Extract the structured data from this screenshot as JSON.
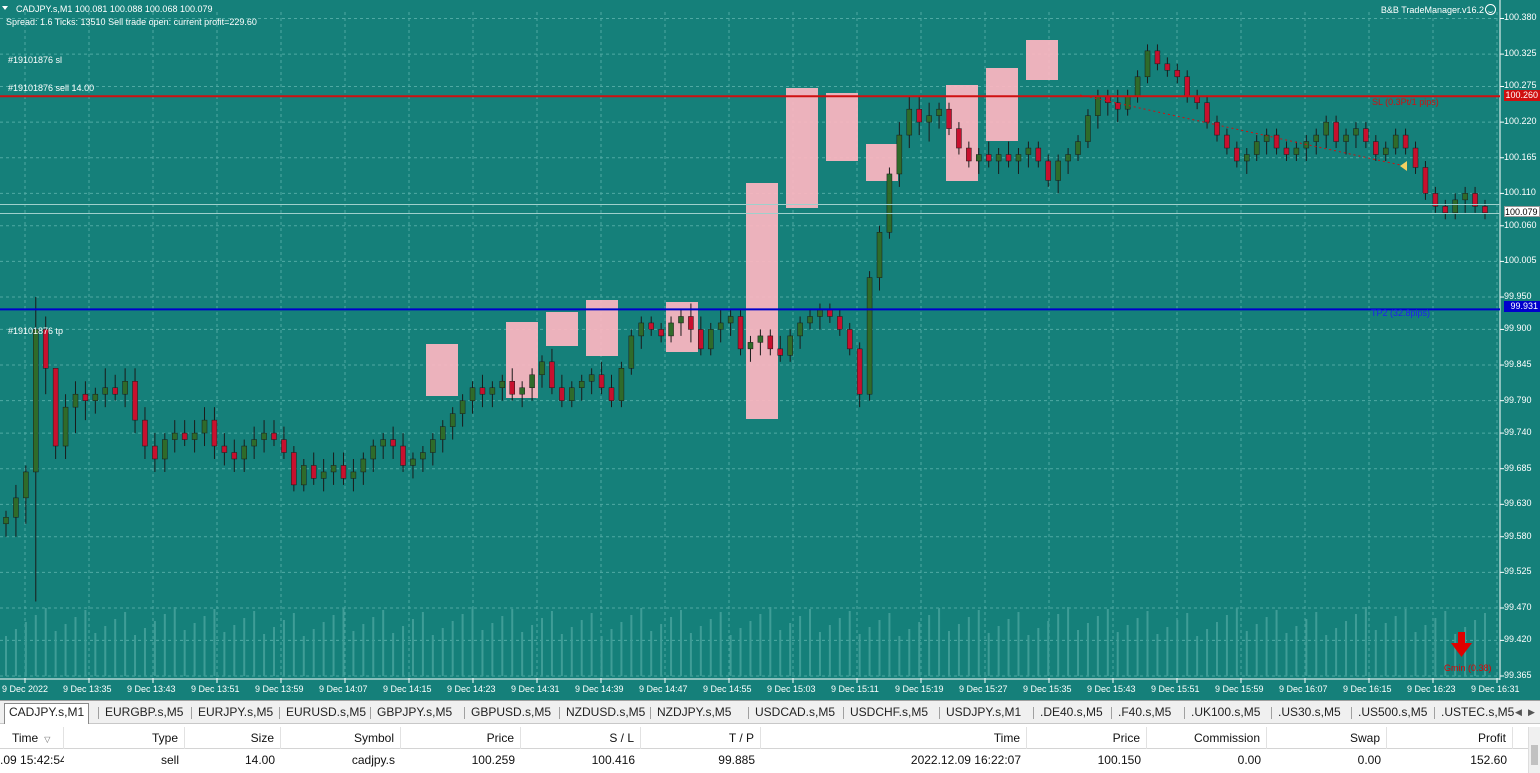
{
  "header": {
    "title": "CADJPY.s,M1  100.081 100.088 100.068 100.079",
    "info": "Spread: 1.6   Ticks: 13510   Sell trade open: current profit=229.60",
    "tm_title": "B&B TradeManager.v16.2"
  },
  "annotations": {
    "sl_order": "#19101876 sl",
    "sell_order": "#19101876 sell 14.00",
    "tp_order": "#19101876 tp",
    "sl_label": "SL (0.3Pt/1 pips)",
    "tp_label": "TP2 (32.8pips)",
    "signal_label": "Gmin (0.38)"
  },
  "price_badges": {
    "sl": "100.260",
    "current": "100.079",
    "tp": "99.931"
  },
  "colors": {
    "chart_bg": "#15807a",
    "bull": "#2f6b2a",
    "bear": "#c8102e",
    "sl_line": "#d01010",
    "tp_line": "#0000cc",
    "box": "#ffb6c1"
  },
  "icons": {
    "signal": "red-down-arrow-icon",
    "status": "smiley-icon",
    "collapse": "triangle-down-icon"
  },
  "chart_data": {
    "type": "candlestick",
    "symbol": "CADJPY.s",
    "timeframe": "M1",
    "y_ticks": [
      100.38,
      100.325,
      100.275,
      100.22,
      100.165,
      100.11,
      100.06,
      100.005,
      99.95,
      99.9,
      99.845,
      99.79,
      99.74,
      99.685,
      99.63,
      99.58,
      99.525,
      99.47,
      99.42,
      99.365
    ],
    "y_ticks_text": [
      "100.380",
      "100.325",
      "100.275",
      "100.220",
      "100.165",
      "100.110",
      "100.060",
      "100.005",
      "99.950",
      "99.900",
      "99.845",
      "99.790",
      "99.740",
      "99.685",
      "99.630",
      "99.580",
      "99.525",
      "99.470",
      "99.420",
      "99.365"
    ],
    "ylim": [
      99.365,
      100.39
    ],
    "x_ticks": [
      "9 Dec 2022",
      "9 Dec 13:35",
      "9 Dec 13:43",
      "9 Dec 13:51",
      "9 Dec 13:59",
      "9 Dec 14:07",
      "9 Dec 14:15",
      "9 Dec 14:23",
      "9 Dec 14:31",
      "9 Dec 14:39",
      "9 Dec 14:47",
      "9 Dec 14:55",
      "9 Dec 15:03",
      "9 Dec 15:11",
      "9 Dec 15:19",
      "9 Dec 15:27",
      "9 Dec 15:35",
      "9 Dec 15:43",
      "9 Dec 15:51",
      "9 Dec 15:59",
      "9 Dec 16:07",
      "9 Dec 16:15",
      "9 Dec 16:23",
      "9 Dec 16:31"
    ],
    "sl_price": 100.26,
    "tp_price": 99.931,
    "current_price": 100.079,
    "grid": true,
    "candles": [
      [
        99.6,
        99.62,
        99.58,
        99.61
      ],
      [
        99.61,
        99.66,
        99.58,
        99.64
      ],
      [
        99.64,
        99.69,
        99.6,
        99.68
      ],
      [
        99.68,
        99.95,
        99.48,
        99.9
      ],
      [
        99.9,
        99.92,
        99.8,
        99.84
      ],
      [
        99.84,
        99.82,
        99.7,
        99.72
      ],
      [
        99.72,
        99.8,
        99.7,
        99.78
      ],
      [
        99.78,
        99.82,
        99.74,
        99.8
      ],
      [
        99.8,
        99.82,
        99.76,
        99.79
      ],
      [
        99.79,
        99.81,
        99.77,
        99.8
      ],
      [
        99.8,
        99.84,
        99.78,
        99.81
      ],
      [
        99.81,
        99.83,
        99.79,
        99.8
      ],
      [
        99.8,
        99.84,
        99.78,
        99.82
      ],
      [
        99.82,
        99.84,
        99.74,
        99.76
      ],
      [
        99.76,
        99.78,
        99.7,
        99.72
      ],
      [
        99.72,
        99.74,
        99.68,
        99.7
      ],
      [
        99.7,
        99.74,
        99.68,
        99.73
      ],
      [
        99.73,
        99.76,
        99.71,
        99.74
      ],
      [
        99.74,
        99.76,
        99.72,
        99.73
      ],
      [
        99.73,
        99.76,
        99.71,
        99.74
      ],
      [
        99.74,
        99.78,
        99.72,
        99.76
      ],
      [
        99.76,
        99.78,
        99.7,
        99.72
      ],
      [
        99.72,
        99.74,
        99.69,
        99.71
      ],
      [
        99.71,
        99.73,
        99.68,
        99.7
      ],
      [
        99.7,
        99.73,
        99.68,
        99.72
      ],
      [
        99.72,
        99.75,
        99.7,
        99.73
      ],
      [
        99.73,
        99.76,
        99.71,
        99.74
      ],
      [
        99.74,
        99.76,
        99.72,
        99.73
      ],
      [
        99.73,
        99.75,
        99.7,
        99.71
      ],
      [
        99.71,
        99.72,
        99.65,
        99.66
      ],
      [
        99.66,
        99.7,
        99.65,
        99.69
      ],
      [
        99.69,
        99.71,
        99.66,
        99.67
      ],
      [
        99.67,
        99.7,
        99.65,
        99.68
      ],
      [
        99.68,
        99.71,
        99.66,
        99.69
      ],
      [
        99.69,
        99.71,
        99.66,
        99.67
      ],
      [
        99.67,
        99.7,
        99.65,
        99.68
      ],
      [
        99.68,
        99.71,
        99.66,
        99.7
      ],
      [
        99.7,
        99.73,
        99.68,
        99.72
      ],
      [
        99.72,
        99.74,
        99.7,
        99.73
      ],
      [
        99.73,
        99.75,
        99.7,
        99.72
      ],
      [
        99.72,
        99.74,
        99.68,
        99.69
      ],
      [
        99.69,
        99.71,
        99.67,
        99.7
      ],
      [
        99.7,
        99.72,
        99.68,
        99.71
      ],
      [
        99.71,
        99.74,
        99.69,
        99.73
      ],
      [
        99.73,
        99.76,
        99.71,
        99.75
      ],
      [
        99.75,
        99.78,
        99.73,
        99.77
      ],
      [
        99.77,
        99.8,
        99.75,
        99.79
      ],
      [
        99.79,
        99.82,
        99.77,
        99.81
      ],
      [
        99.81,
        99.83,
        99.78,
        99.8
      ],
      [
        99.8,
        99.82,
        99.78,
        99.81
      ],
      [
        99.81,
        99.83,
        99.79,
        99.82
      ],
      [
        99.82,
        99.84,
        99.79,
        99.8
      ],
      [
        99.8,
        99.82,
        99.78,
        99.81
      ],
      [
        99.81,
        99.84,
        99.79,
        99.83
      ],
      [
        99.83,
        99.86,
        99.81,
        99.85
      ],
      [
        99.85,
        99.87,
        99.8,
        99.81
      ],
      [
        99.81,
        99.83,
        99.78,
        99.79
      ],
      [
        99.79,
        99.82,
        99.78,
        99.81
      ],
      [
        99.81,
        99.83,
        99.79,
        99.82
      ],
      [
        99.82,
        99.84,
        99.8,
        99.83
      ],
      [
        99.83,
        99.85,
        99.8,
        99.81
      ],
      [
        99.81,
        99.83,
        99.78,
        99.79
      ],
      [
        99.79,
        99.85,
        99.78,
        99.84
      ],
      [
        99.84,
        99.9,
        99.83,
        99.89
      ],
      [
        99.89,
        99.92,
        99.87,
        99.91
      ],
      [
        99.91,
        99.92,
        99.89,
        99.9
      ],
      [
        99.9,
        99.91,
        99.88,
        99.89
      ],
      [
        99.89,
        99.92,
        99.88,
        99.91
      ],
      [
        99.91,
        99.93,
        99.89,
        99.92
      ],
      [
        99.92,
        99.94,
        99.88,
        99.9
      ],
      [
        99.9,
        99.92,
        99.86,
        99.87
      ],
      [
        99.87,
        99.91,
        99.86,
        99.9
      ],
      [
        99.9,
        99.93,
        99.88,
        99.91
      ],
      [
        99.91,
        99.93,
        99.89,
        99.92
      ],
      [
        99.92,
        99.93,
        99.86,
        99.87
      ],
      [
        99.87,
        99.89,
        99.85,
        99.88
      ],
      [
        99.88,
        99.9,
        99.86,
        99.89
      ],
      [
        99.89,
        99.9,
        99.86,
        99.87
      ],
      [
        99.87,
        99.89,
        99.85,
        99.86
      ],
      [
        99.86,
        99.9,
        99.85,
        99.89
      ],
      [
        99.89,
        99.92,
        99.87,
        99.91
      ],
      [
        99.91,
        99.93,
        99.9,
        99.92
      ],
      [
        99.92,
        99.94,
        99.9,
        99.93
      ],
      [
        99.93,
        99.94,
        99.91,
        99.92
      ],
      [
        99.92,
        99.93,
        99.89,
        99.9
      ],
      [
        99.9,
        99.91,
        99.86,
        99.87
      ],
      [
        99.87,
        99.88,
        99.78,
        99.8
      ],
      [
        99.8,
        99.99,
        99.79,
        99.98
      ],
      [
        99.98,
        100.06,
        99.96,
        100.05
      ],
      [
        100.05,
        100.15,
        100.04,
        100.14
      ],
      [
        100.14,
        100.22,
        100.12,
        100.2
      ],
      [
        100.2,
        100.26,
        100.18,
        100.24
      ],
      [
        100.24,
        100.26,
        100.2,
        100.22
      ],
      [
        100.22,
        100.25,
        100.19,
        100.23
      ],
      [
        100.23,
        100.25,
        100.21,
        100.24
      ],
      [
        100.24,
        100.25,
        100.2,
        100.21
      ],
      [
        100.21,
        100.22,
        100.17,
        100.18
      ],
      [
        100.18,
        100.19,
        100.15,
        100.16
      ],
      [
        100.16,
        100.18,
        100.14,
        100.17
      ],
      [
        100.17,
        100.19,
        100.15,
        100.16
      ],
      [
        100.16,
        100.18,
        100.14,
        100.17
      ],
      [
        100.17,
        100.19,
        100.15,
        100.16
      ],
      [
        100.16,
        100.18,
        100.14,
        100.17
      ],
      [
        100.17,
        100.19,
        100.15,
        100.18
      ],
      [
        100.18,
        100.19,
        100.15,
        100.16
      ],
      [
        100.16,
        100.17,
        100.12,
        100.13
      ],
      [
        100.13,
        100.17,
        100.11,
        100.16
      ],
      [
        100.16,
        100.18,
        100.14,
        100.17
      ],
      [
        100.17,
        100.2,
        100.16,
        100.19
      ],
      [
        100.19,
        100.24,
        100.18,
        100.23
      ],
      [
        100.23,
        100.27,
        100.21,
        100.26
      ],
      [
        100.26,
        100.27,
        100.23,
        100.25
      ],
      [
        100.25,
        100.27,
        100.22,
        100.24
      ],
      [
        100.24,
        100.27,
        100.23,
        100.26
      ],
      [
        100.26,
        100.3,
        100.25,
        100.29
      ],
      [
        100.29,
        100.34,
        100.28,
        100.33
      ],
      [
        100.33,
        100.34,
        100.3,
        100.31
      ],
      [
        100.31,
        100.32,
        100.29,
        100.3
      ],
      [
        100.3,
        100.31,
        100.28,
        100.29
      ],
      [
        100.29,
        100.3,
        100.25,
        100.26
      ],
      [
        100.26,
        100.27,
        100.24,
        100.25
      ],
      [
        100.25,
        100.26,
        100.21,
        100.22
      ],
      [
        100.22,
        100.23,
        100.19,
        100.2
      ],
      [
        100.2,
        100.21,
        100.17,
        100.18
      ],
      [
        100.18,
        100.19,
        100.15,
        100.16
      ],
      [
        100.16,
        100.18,
        100.14,
        100.17
      ],
      [
        100.17,
        100.2,
        100.16,
        100.19
      ],
      [
        100.19,
        100.21,
        100.17,
        100.2
      ],
      [
        100.2,
        100.21,
        100.17,
        100.18
      ],
      [
        100.18,
        100.19,
        100.16,
        100.17
      ],
      [
        100.17,
        100.19,
        100.16,
        100.18
      ],
      [
        100.18,
        100.2,
        100.16,
        100.19
      ],
      [
        100.19,
        100.21,
        100.17,
        100.2
      ],
      [
        100.2,
        100.23,
        100.18,
        100.22
      ],
      [
        100.22,
        100.23,
        100.18,
        100.19
      ],
      [
        100.19,
        100.21,
        100.17,
        100.2
      ],
      [
        100.2,
        100.22,
        100.18,
        100.21
      ],
      [
        100.21,
        100.22,
        100.18,
        100.19
      ],
      [
        100.19,
        100.2,
        100.16,
        100.17
      ],
      [
        100.17,
        100.19,
        100.16,
        100.18
      ],
      [
        100.18,
        100.21,
        100.17,
        100.2
      ],
      [
        100.2,
        100.21,
        100.17,
        100.18
      ],
      [
        100.18,
        100.19,
        100.14,
        100.15
      ],
      [
        100.15,
        100.16,
        100.1,
        100.11
      ],
      [
        100.11,
        100.12,
        100.08,
        100.09
      ],
      [
        100.09,
        100.1,
        100.07,
        100.08
      ],
      [
        100.08,
        100.11,
        100.07,
        100.1
      ],
      [
        100.1,
        100.12,
        100.08,
        100.11
      ],
      [
        100.11,
        100.12,
        100.08,
        100.09
      ],
      [
        100.09,
        100.1,
        100.07,
        100.08
      ]
    ]
  },
  "tabs": [
    {
      "label": "CADJPY.s,M1",
      "active": true
    },
    {
      "label": "EURGBP.s,M5"
    },
    {
      "label": "EURJPY.s,M5"
    },
    {
      "label": "EURUSD.s,M5"
    },
    {
      "label": "GBPJPY.s,M5"
    },
    {
      "label": "GBPUSD.s,M5"
    },
    {
      "label": "NZDUSD.s,M5"
    },
    {
      "label": "NZDJPY.s,M5"
    },
    {
      "label": "USDCAD.s,M5"
    },
    {
      "label": "USDCHF.s,M5"
    },
    {
      "label": "USDJPY.s,M1"
    },
    {
      "label": ".DE40.s,M5"
    },
    {
      "label": ".F40.s,M5"
    },
    {
      "label": ".UK100.s,M5"
    },
    {
      "label": ".US30.s,M5"
    },
    {
      "label": ".US500.s,M5"
    },
    {
      "label": ".USTEC.s,M5"
    }
  ],
  "grid": {
    "columns": [
      "Time",
      "Type",
      "Size",
      "Symbol",
      "Price",
      "S / L",
      "T / P",
      "Time",
      "Price",
      "Commission",
      "Swap",
      "Profit"
    ],
    "row": [
      ".09 15:42:54",
      "sell",
      "14.00",
      "cadjpy.s",
      "100.259",
      "100.416",
      "99.885",
      "2022.12.09 16:22:07",
      "100.150",
      "0.00",
      "0.00",
      "152.60"
    ]
  }
}
